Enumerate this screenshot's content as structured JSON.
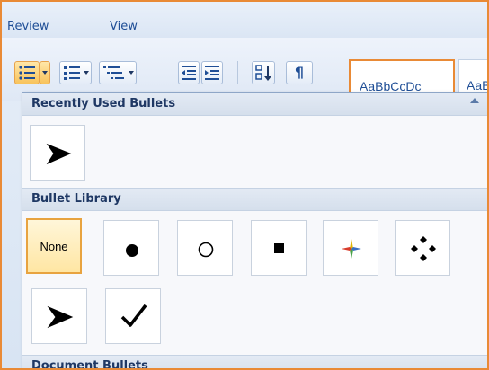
{
  "ribbon": {
    "tabs": [
      {
        "label": "Review"
      },
      {
        "label": "View"
      }
    ],
    "toolbar": {
      "pilcrow_symbol": "¶",
      "styles": [
        {
          "label": "AaBbCcDc"
        },
        {
          "label": "AaBb"
        }
      ]
    }
  },
  "bullet_menu": {
    "sections": [
      {
        "title": "Recently Used Bullets",
        "items": [
          {
            "icon": "arrowhead-bullet-icon"
          }
        ]
      },
      {
        "title": "Bullet Library",
        "items": [
          {
            "label": "None",
            "selected": true
          },
          {
            "icon": "filled-circle-bullet-icon"
          },
          {
            "icon": "hollow-circle-bullet-icon"
          },
          {
            "icon": "filled-square-bullet-icon"
          },
          {
            "icon": "four-color-star-bullet-icon"
          },
          {
            "icon": "diamond-cluster-bullet-icon"
          },
          {
            "icon": "arrowhead-bullet-icon"
          },
          {
            "icon": "checkmark-bullet-icon"
          }
        ]
      },
      {
        "title": "Document Bullets",
        "items": []
      }
    ]
  },
  "colors": {
    "accent_orange": "#e98a36",
    "header_text": "#1f3864",
    "tab_text": "#1f4e96"
  }
}
